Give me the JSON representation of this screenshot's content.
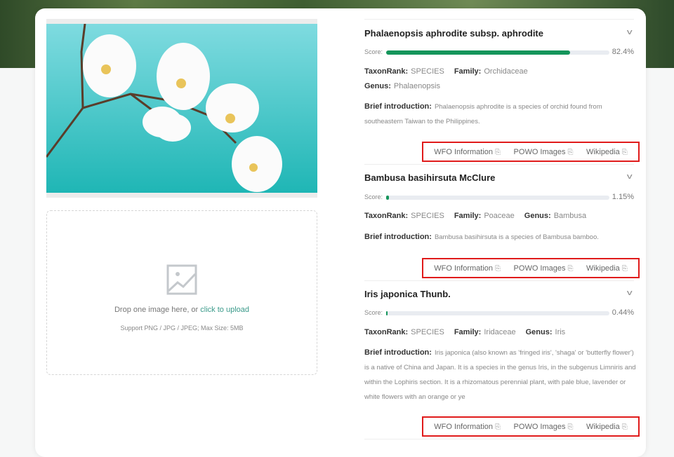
{
  "upload": {
    "drop_text": "Drop one image here, or ",
    "click_text": "click to upload",
    "hint": "Support PNG / JPG / JPEG; Max Size: 5MB"
  },
  "labels": {
    "score": "Score:",
    "taxon": "TaxonRank:",
    "family": "Family:",
    "genus": "Genus:",
    "intro": "Brief introduction:"
  },
  "links": {
    "wfo": "WFO Information",
    "powo": "POWO Images",
    "wiki": "Wikipedia"
  },
  "results": [
    {
      "name": "Phalaenopsis aphrodite subsp. aphrodite",
      "score_pct": 82.4,
      "score": "82.4%",
      "rank": "SPECIES",
      "family": "Orchidaceae",
      "genus": "Phalaenopsis",
      "intro": "Phalaenopsis aphrodite is a species of orchid found from southeastern Taiwan to the Philippines."
    },
    {
      "name": "Bambusa basihirsuta McClure",
      "score_pct": 1.15,
      "score": "1.15%",
      "rank": "SPECIES",
      "family": "Poaceae",
      "genus": "Bambusa",
      "intro": "Bambusa basihirsuta is a species of Bambusa bamboo."
    },
    {
      "name": "Iris japonica Thunb.",
      "score_pct": 0.44,
      "score": "0.44%",
      "rank": "SPECIES",
      "family": "Iridaceae",
      "genus": "Iris",
      "intro": "Iris japonica (also known as 'fringed iris', 'shaga' or 'butterfly flower') is a native of China and Japan. It is a species in the genus Iris, in the subgenus Limniris and within the Lophiris section. It is a rhizomatous perennial plant, with pale blue, lavender or white flowers with an orange or ye"
    }
  ],
  "colors": {
    "accent": "#14955b",
    "link_box": "#e01b1b"
  }
}
